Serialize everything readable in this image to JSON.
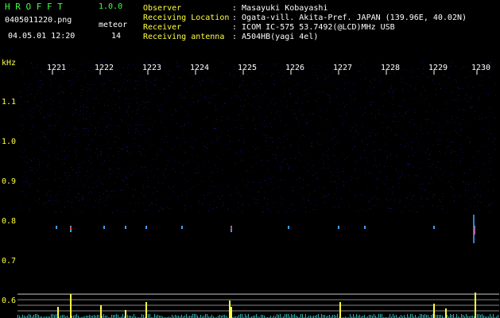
{
  "app": {
    "name": "H R O F F T",
    "version": "1.0.0",
    "filename": "0405011220.png",
    "datetime": "04.05.01 12:20",
    "meteor_label": "meteor",
    "meteor_count": "14"
  },
  "info": {
    "observer_label": "Observer",
    "observer_value": ": Masayuki Kobayashi",
    "location_label": "Receiving Location",
    "location_value": ": Ogata-vill. Akita-Pref. JAPAN (139.96E, 40.02N)",
    "receiver_label": "Receiver",
    "receiver_value": ": ICOM IC-575 53.7492(@LCD)MHz USB",
    "antenna_label": "Receiving antenna",
    "antenna_value": ": A504HB(yagi 4el)"
  },
  "axis": {
    "unit": "kHz",
    "y_ticks": [
      "1.1",
      "1.0",
      "0.9",
      "0.8",
      "0.7",
      "0.6"
    ],
    "x_ticks": [
      "1221",
      "1222",
      "1223",
      "1224",
      "1225",
      "1226",
      "1227",
      "1228",
      "1229",
      "1230"
    ]
  },
  "colors": {
    "background": "#000000",
    "noise": "#1a1a80",
    "signal_line": "#ffff40",
    "meteor_hot": "#ff4040",
    "meteor_warm": "#40a0ff",
    "baseline": "#40ffff",
    "accent_green": "#40ff40"
  }
}
